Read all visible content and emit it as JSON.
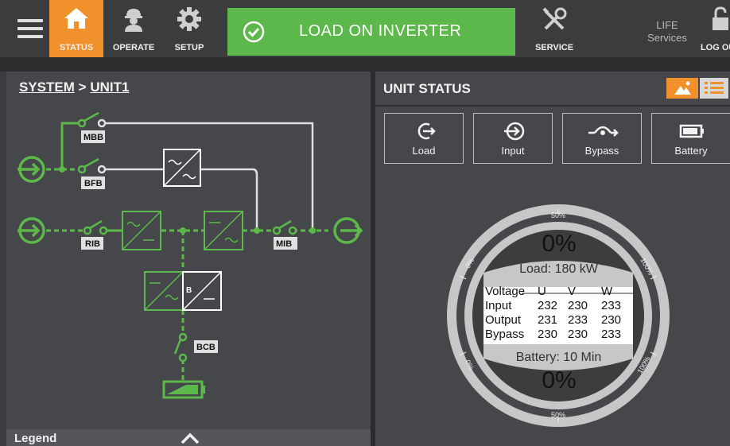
{
  "topbar": {
    "status_label": "STATUS",
    "operate_label": "OPERATE",
    "setup_label": "SETUP",
    "banner_text": "LOAD ON INVERTER",
    "service_label": "SERVICE",
    "life_line1": "LIFE",
    "life_line2": "Services",
    "logout_label": "LOG OUT"
  },
  "left": {
    "crumb_system": "SYSTEM",
    "crumb_sep": ">",
    "crumb_unit": "UNIT1",
    "breakers": {
      "mbb": "MBB",
      "bfb": "BFB",
      "rib": "RIB",
      "mib": "MIB",
      "bcb": "BCB"
    },
    "converter_label": "B",
    "legend": "Legend"
  },
  "right": {
    "title": "UNIT STATUS",
    "tabs": [
      {
        "label": "Load",
        "icon": "load-arrow-icon"
      },
      {
        "label": "Input",
        "icon": "input-arrow-icon"
      },
      {
        "label": "Bypass",
        "icon": "bypass-icon"
      },
      {
        "label": "Battery",
        "icon": "battery-icon"
      }
    ],
    "gauge": {
      "load_percent": "0%",
      "load_text": "Load: 180 kW",
      "battery_percent": "0%",
      "battery_text": "Battery: 10 Min",
      "tick_top": "50%",
      "tick_bottom": "50%",
      "tick_left": "0%",
      "tick_right": "100%",
      "tick_bottom_left": "0%",
      "tick_bottom_right": "100%",
      "load_level": 0,
      "battery_level": 0
    },
    "voltage_table": {
      "headers": [
        "Voltage",
        "U",
        "V",
        "W"
      ],
      "rows": [
        [
          "Input",
          "232",
          "230",
          "233"
        ],
        [
          "Output",
          "231",
          "233",
          "230"
        ],
        [
          "Bypass",
          "230",
          "230",
          "233"
        ]
      ]
    }
  },
  "colors": {
    "accent": "#f0912c",
    "ok_green": "#5cb84a",
    "flow_green": "#5cb84a",
    "panel": "#46474a"
  }
}
